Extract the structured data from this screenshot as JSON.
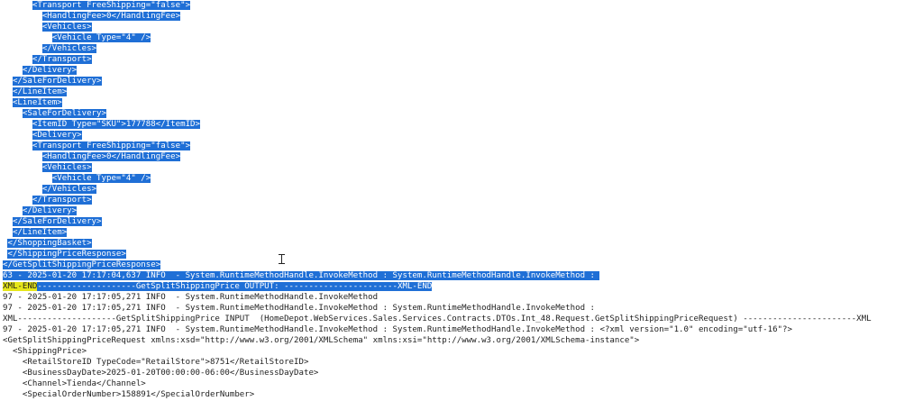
{
  "log": {
    "lines": [
      {
        "segments": [
          {
            "text": "      "
          },
          {
            "text": "<Transport FreeShipping=\"false\">",
            "style": "sel"
          }
        ]
      },
      {
        "segments": [
          {
            "text": "        "
          },
          {
            "text": "<HandlingFee>0</HandlingFee>",
            "style": "sel"
          }
        ]
      },
      {
        "segments": [
          {
            "text": "        "
          },
          {
            "text": "<Vehicles>",
            "style": "sel"
          }
        ]
      },
      {
        "segments": [
          {
            "text": "          "
          },
          {
            "text": "<Vehicle Type=\"4\" />",
            "style": "sel"
          }
        ]
      },
      {
        "segments": [
          {
            "text": "        "
          },
          {
            "text": "</Vehicles>",
            "style": "sel"
          }
        ]
      },
      {
        "segments": [
          {
            "text": "      "
          },
          {
            "text": "</Transport>",
            "style": "sel"
          }
        ]
      },
      {
        "segments": [
          {
            "text": "    "
          },
          {
            "text": "</Delivery>",
            "style": "sel"
          }
        ]
      },
      {
        "segments": [
          {
            "text": "  "
          },
          {
            "text": "</SaleForDelivery>",
            "style": "sel"
          }
        ]
      },
      {
        "segments": [
          {
            "text": "  "
          },
          {
            "text": "</LineItem>",
            "style": "sel"
          }
        ]
      },
      {
        "segments": [
          {
            "text": "  "
          },
          {
            "text": "<LineItem>",
            "style": "sel"
          }
        ]
      },
      {
        "segments": [
          {
            "text": "    "
          },
          {
            "text": "<SaleForDelivery>",
            "style": "sel"
          }
        ]
      },
      {
        "segments": [
          {
            "text": "      "
          },
          {
            "text": "<ItemID Type=\"SKU\">177788</ItemID>",
            "style": "sel"
          }
        ]
      },
      {
        "segments": [
          {
            "text": "      "
          },
          {
            "text": "<Delivery>",
            "style": "sel"
          }
        ]
      },
      {
        "segments": [
          {
            "text": "      "
          },
          {
            "text": "<Transport FreeShipping=\"false\">",
            "style": "sel"
          }
        ]
      },
      {
        "segments": [
          {
            "text": "        "
          },
          {
            "text": "<HandlingFee>0</HandlingFee>",
            "style": "sel"
          }
        ]
      },
      {
        "segments": [
          {
            "text": "        "
          },
          {
            "text": "<Vehicles>",
            "style": "sel"
          }
        ]
      },
      {
        "segments": [
          {
            "text": "          "
          },
          {
            "text": "<Vehicle Type=\"4\" />",
            "style": "sel"
          }
        ]
      },
      {
        "segments": [
          {
            "text": "        "
          },
          {
            "text": "</Vehicles>",
            "style": "sel"
          }
        ]
      },
      {
        "segments": [
          {
            "text": "      "
          },
          {
            "text": "</Transport>",
            "style": "sel"
          }
        ]
      },
      {
        "segments": [
          {
            "text": "    "
          },
          {
            "text": "</Delivery>",
            "style": "sel"
          }
        ]
      },
      {
        "segments": [
          {
            "text": "  "
          },
          {
            "text": "</SaleForDelivery>",
            "style": "sel"
          }
        ]
      },
      {
        "segments": [
          {
            "text": "  "
          },
          {
            "text": "</LineItem>",
            "style": "sel"
          }
        ]
      },
      {
        "segments": [
          {
            "text": " "
          },
          {
            "text": "</ShoppingBasket>",
            "style": "sel"
          }
        ]
      },
      {
        "segments": [
          {
            "text": " "
          },
          {
            "text": "</ShippingPriceResponse>",
            "style": "sel"
          }
        ]
      },
      {
        "segments": [
          {
            "text": "</GetSplitShippingPriceResponse>",
            "style": "sel"
          }
        ]
      },
      {
        "segments": [
          {
            "text": "63 - 2025-01-20 17:17:04,637 INFO  - System.RuntimeMethodHandle.InvokeMethod : System.RuntimeMethodHandle.InvokeMethod : ",
            "style": "sel"
          }
        ]
      },
      {
        "segments": [
          {
            "text": "XML-END",
            "style": "hl"
          },
          {
            "text": "--------------------GetSplitShippingPrice OUTPUT: -----------------------XML-END",
            "style": "sel"
          }
        ]
      },
      {
        "segments": [
          {
            "text": "97 - 2025-01-20 17:17:05,271 INFO  - System.RuntimeMethodHandle.InvokeMethod"
          }
        ]
      },
      {
        "segments": [
          {
            "text": "97 - 2025-01-20 17:17:05,271 INFO  - System.RuntimeMethodHandle.InvokeMethod : System.RuntimeMethodHandle.InvokeMethod :"
          }
        ]
      },
      {
        "segments": [
          {
            "text": "XML--------------------GetSplitShippingPrice INPUT  (HomeDepot.WebServices.Sales.Services.Contracts.DTOs.Int_48.Request.GetSplitShippingPriceRequest) -----------------------XML"
          }
        ]
      },
      {
        "segments": [
          {
            "text": "97 - 2025-01-20 17:17:05,271 INFO  - System.RuntimeMethodHandle.InvokeMethod : System.RuntimeMethodHandle.InvokeMethod : <?xml version=\"1.0\" encoding=\"utf-16\"?>"
          }
        ]
      },
      {
        "segments": [
          {
            "text": "<GetSplitShippingPriceRequest xmlns:xsd=\"http://www.w3.org/2001/XMLSchema\" xmlns:xsi=\"http://www.w3.org/2001/XMLSchema-instance\">"
          }
        ]
      },
      {
        "segments": [
          {
            "text": "  <ShippingPrice>"
          }
        ]
      },
      {
        "segments": [
          {
            "text": "    <RetailStoreID TypeCode=\"RetailStore\">8751</RetailStoreID>"
          }
        ]
      },
      {
        "segments": [
          {
            "text": "    <BusinessDayDate>2025-01-20T00:00:00-06:00</BusinessDayDate>"
          }
        ]
      },
      {
        "segments": [
          {
            "text": "    <Channel>Tienda</Channel>"
          }
        ]
      },
      {
        "segments": [
          {
            "text": "    <SpecialOrderNumber>158891</SpecialOrderNumber>"
          }
        ]
      }
    ]
  }
}
